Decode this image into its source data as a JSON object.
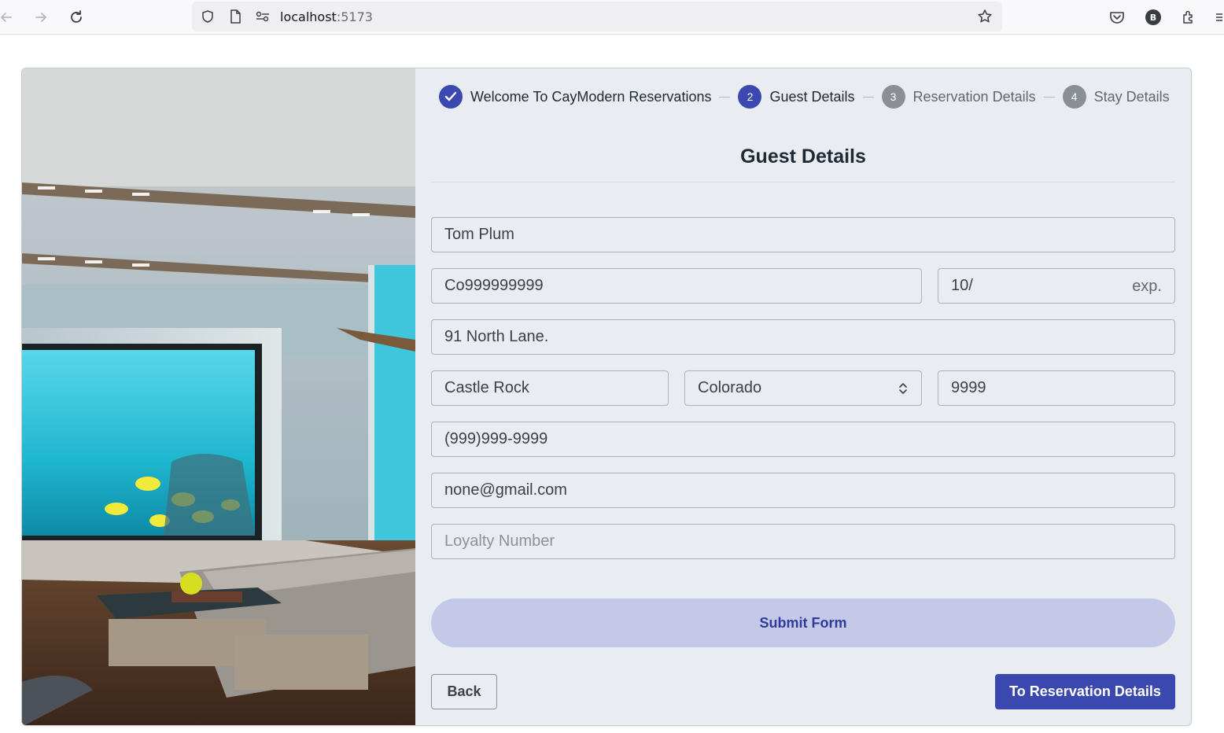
{
  "browser": {
    "url_host": "localhost",
    "url_port": ":5173",
    "profile_initial": "B"
  },
  "hero": {
    "image_desc": "underwater-suite-lounge"
  },
  "stepper": {
    "steps": [
      {
        "number": "1",
        "label": "Welcome To CayModern Reservations",
        "state": "done"
      },
      {
        "number": "2",
        "label": "Guest Details",
        "state": "active"
      },
      {
        "number": "3",
        "label": "Reservation Details",
        "state": "todo"
      },
      {
        "number": "4",
        "label": "Stay Details",
        "state": "todo"
      }
    ]
  },
  "form": {
    "title": "Guest Details",
    "fields": {
      "name": {
        "value": "Tom Plum",
        "placeholder": ""
      },
      "card": {
        "value": "Co999999999",
        "placeholder": ""
      },
      "expiry": {
        "value": "10/",
        "adornment": "exp."
      },
      "address": {
        "value": "91 North Lane.",
        "placeholder": ""
      },
      "city": {
        "value": "Castle Rock",
        "placeholder": ""
      },
      "state": {
        "value": "Colorado"
      },
      "zip": {
        "value": "9999",
        "placeholder": ""
      },
      "phone": {
        "value": "(999)999-9999",
        "placeholder": ""
      },
      "email": {
        "value": "none@gmail.com",
        "placeholder": ""
      },
      "loyalty": {
        "value": "",
        "placeholder": "Loyalty Number"
      }
    },
    "submit_label": "Submit Form",
    "back_label": "Back",
    "next_label": "To Reservation Details"
  },
  "colors": {
    "primary": "#3a48b0",
    "submit_bg": "#c5c9e8",
    "panel_bg": "#e9edf1"
  }
}
